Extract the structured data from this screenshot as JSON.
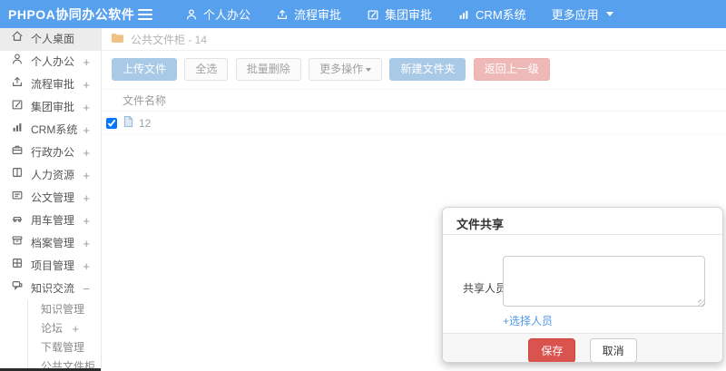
{
  "topbar": {
    "logo": "PHPOA协同办公软件",
    "nav": [
      {
        "label": "个人办公",
        "icon": "user-icon"
      },
      {
        "label": "流程审批",
        "icon": "flow-icon"
      },
      {
        "label": "集团审批",
        "icon": "edit-icon"
      },
      {
        "label": "CRM系统",
        "icon": "chart-icon"
      },
      {
        "label": "更多应用",
        "icon": "caret-down-icon"
      }
    ]
  },
  "sidebar": {
    "expand_glyph": "+",
    "collapse_glyph": "−",
    "items": [
      {
        "label": "个人桌面",
        "icon": "home-icon",
        "active": true
      },
      {
        "label": "个人办公",
        "icon": "user-icon"
      },
      {
        "label": "流程审批",
        "icon": "flow-icon"
      },
      {
        "label": "集团审批",
        "icon": "edit-icon"
      },
      {
        "label": "CRM系统",
        "icon": "chart-icon"
      },
      {
        "label": "行政办公",
        "icon": "briefcase-icon"
      },
      {
        "label": "人力资源",
        "icon": "book-icon"
      },
      {
        "label": "公文管理",
        "icon": "document-icon"
      },
      {
        "label": "用车管理",
        "icon": "car-icon"
      },
      {
        "label": "档案管理",
        "icon": "archive-icon"
      },
      {
        "label": "项目管理",
        "icon": "project-icon"
      },
      {
        "label": "知识交流",
        "icon": "chat-icon",
        "expanded": true,
        "children": [
          {
            "label": "知识管理"
          },
          {
            "label": "论坛",
            "expandable": true
          },
          {
            "label": "下载管理"
          },
          {
            "label": "公共文件柜"
          }
        ]
      }
    ]
  },
  "breadcrumb": {
    "text": "公共文件柜 - 14",
    "icon": "folder-icon"
  },
  "toolbar": {
    "upload": "上传文件",
    "select_all": "全选",
    "batch_delete": "批量删除",
    "more_actions": "更多操作",
    "new_folder": "新建文件夹",
    "back": "返回上一级"
  },
  "table": {
    "header": "文件名称",
    "rows": [
      {
        "name": "12",
        "checked": true
      }
    ]
  },
  "modal": {
    "title": "文件共享",
    "share_label": "共享人员",
    "textarea_value": "",
    "select_link": "+选择人员",
    "save": "保存",
    "cancel": "取消"
  },
  "colors": {
    "topbar_blue": "#56a0ee",
    "primary_blue": "#428bca",
    "danger_red": "#d9534f",
    "link_blue": "#4f99e8",
    "folder_orange": "#f0c384",
    "active_item_bg": "#ececec"
  }
}
